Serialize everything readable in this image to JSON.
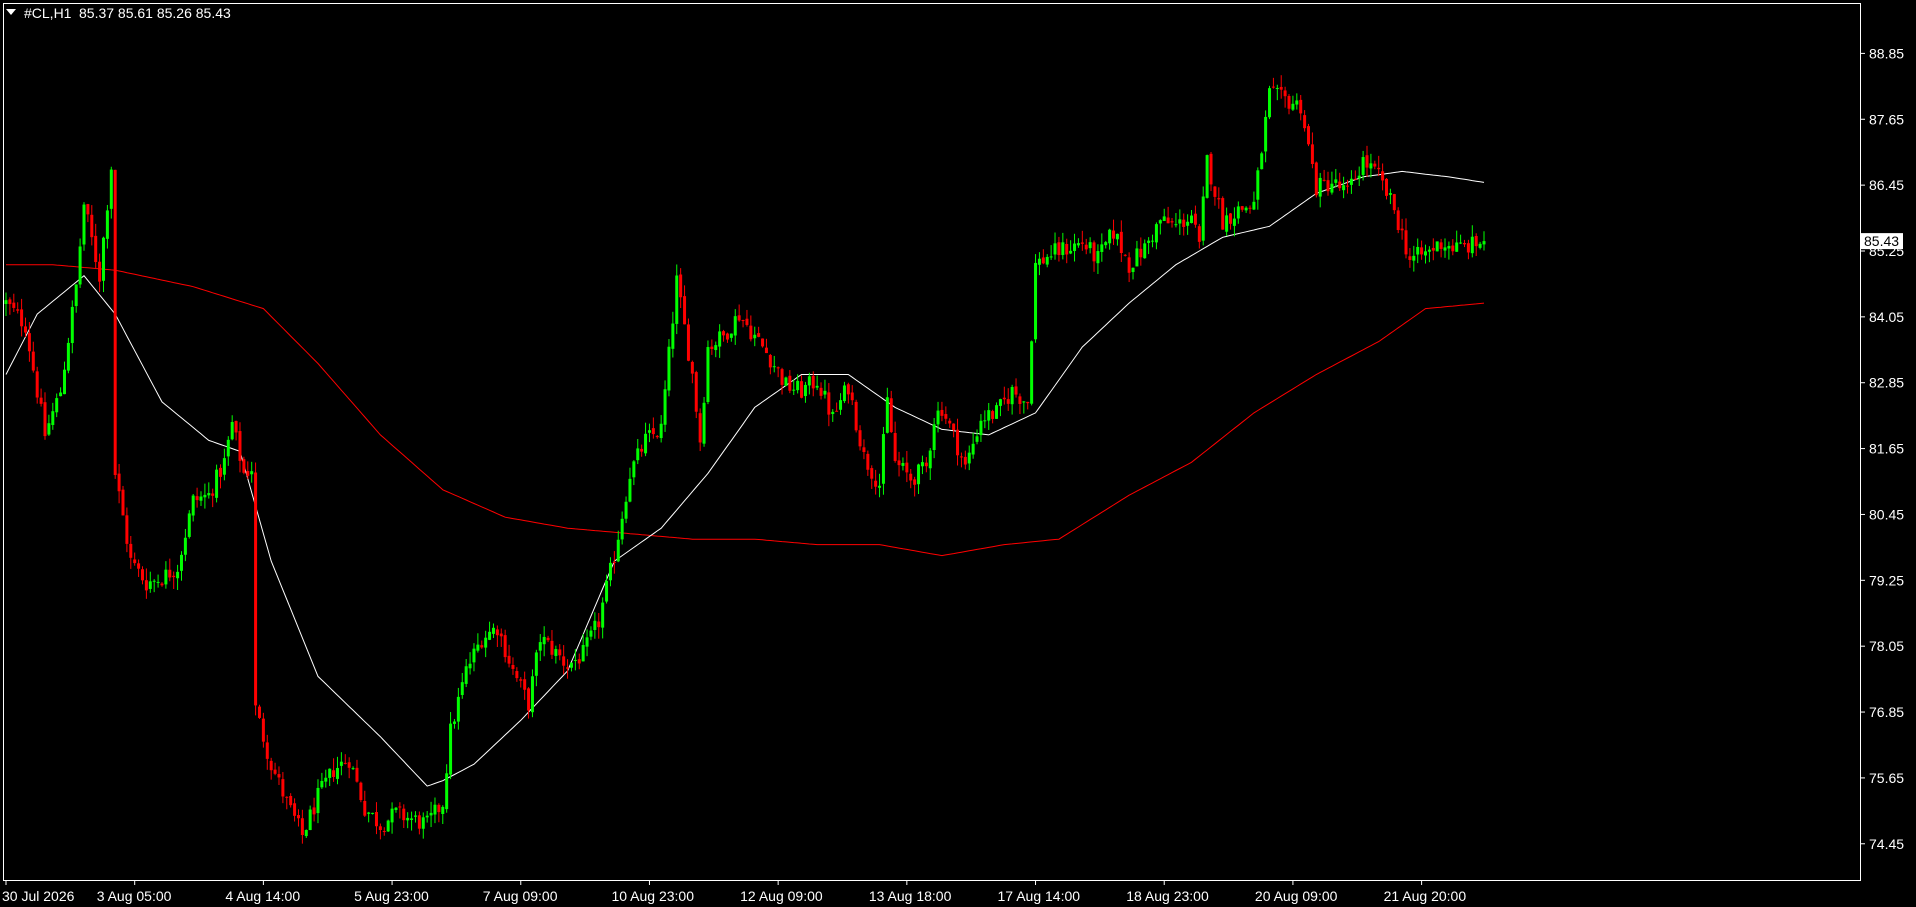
{
  "header": {
    "symbol": "#CL,H1",
    "ohlc": "85.37 85.61 85.26 85.43"
  },
  "chart_data": {
    "type": "candlestick",
    "symbol": "#CL",
    "timeframe": "H1",
    "y_ticks": [
      88.85,
      87.65,
      86.45,
      85.25,
      84.05,
      82.85,
      81.65,
      80.45,
      79.25,
      78.05,
      76.85,
      75.65,
      74.45
    ],
    "y_tick_labels": [
      "88.85",
      "87.65",
      "86.45",
      "85.25",
      "84.05",
      "82.85",
      "81.65",
      "80.45",
      "79.25",
      "78.05",
      "76.85",
      "75.65",
      "74.45"
    ],
    "ylim": [
      73.79,
      89.75
    ],
    "x_labels": [
      "30 Jul 2026",
      "3 Aug 05:00",
      "4 Aug 14:00",
      "5 Aug 23:00",
      "7 Aug 09:00",
      "10 Aug 23:00",
      "12 Aug 09:00",
      "13 Aug 18:00",
      "17 Aug 14:00",
      "18 Aug 23:00",
      "20 Aug 09:00",
      "21 Aug 20:00"
    ],
    "x_label_bar_index": [
      0,
      33,
      66,
      99,
      132,
      165,
      198,
      231,
      264,
      297,
      330,
      363
    ],
    "bar_count": 380,
    "bar_spacing_note": "candles evenly spaced",
    "current_price": "85.43",
    "last_ohlc": {
      "open": 85.37,
      "high": 85.61,
      "low": 85.26,
      "close": 85.43
    },
    "colors": {
      "bull": "#00ff00",
      "bear": "#ff0000",
      "fast_ma": "#ffffff",
      "slow_ma": "#ff0000",
      "background": "#000000",
      "axis": "#ffffff",
      "price_box": "#ffffff"
    },
    "anchors": [
      [
        0,
        84.3
      ],
      [
        5,
        83.9
      ],
      [
        10,
        81.9
      ],
      [
        14,
        82.7
      ],
      [
        18,
        84.6
      ],
      [
        20,
        86.1
      ],
      [
        24,
        84.8
      ],
      [
        27,
        86.8
      ],
      [
        28,
        81.2
      ],
      [
        32,
        79.6
      ],
      [
        36,
        79.2
      ],
      [
        40,
        79.3
      ],
      [
        44,
        79.5
      ],
      [
        48,
        80.7
      ],
      [
        52,
        80.8
      ],
      [
        56,
        81.4
      ],
      [
        58,
        82.1
      ],
      [
        61,
        81.2
      ],
      [
        63,
        81.3
      ],
      [
        64,
        76.9
      ],
      [
        68,
        75.9
      ],
      [
        72,
        75.2
      ],
      [
        76,
        74.6
      ],
      [
        80,
        75.3
      ],
      [
        84,
        75.8
      ],
      [
        88,
        76.0
      ],
      [
        92,
        75.1
      ],
      [
        96,
        74.8
      ],
      [
        100,
        75.0
      ],
      [
        104,
        74.9
      ],
      [
        108,
        74.8
      ],
      [
        112,
        75.2
      ],
      [
        114,
        76.5
      ],
      [
        118,
        77.6
      ],
      [
        122,
        78.2
      ],
      [
        126,
        78.4
      ],
      [
        130,
        77.6
      ],
      [
        134,
        77.0
      ],
      [
        137,
        78.2
      ],
      [
        140,
        78.0
      ],
      [
        144,
        77.7
      ],
      [
        148,
        77.9
      ],
      [
        152,
        78.5
      ],
      [
        156,
        79.7
      ],
      [
        160,
        81.2
      ],
      [
        164,
        81.8
      ],
      [
        168,
        82.0
      ],
      [
        172,
        84.7
      ],
      [
        176,
        83.0
      ],
      [
        178,
        81.8
      ],
      [
        180,
        83.5
      ],
      [
        184,
        83.7
      ],
      [
        188,
        84.1
      ],
      [
        192,
        83.7
      ],
      [
        196,
        83.3
      ],
      [
        200,
        82.8
      ],
      [
        204,
        82.7
      ],
      [
        208,
        82.9
      ],
      [
        212,
        82.2
      ],
      [
        216,
        82.8
      ],
      [
        220,
        81.5
      ],
      [
        224,
        81.0
      ],
      [
        226,
        82.5
      ],
      [
        228,
        81.4
      ],
      [
        232,
        81.1
      ],
      [
        236,
        81.3
      ],
      [
        238,
        82.2
      ],
      [
        240,
        82.4
      ],
      [
        244,
        81.7
      ],
      [
        246,
        81.3
      ],
      [
        250,
        82.2
      ],
      [
        254,
        82.3
      ],
      [
        258,
        82.7
      ],
      [
        262,
        82.5
      ],
      [
        264,
        85.0
      ],
      [
        268,
        85.2
      ],
      [
        272,
        85.3
      ],
      [
        276,
        85.4
      ],
      [
        280,
        85.1
      ],
      [
        284,
        85.6
      ],
      [
        288,
        85.0
      ],
      [
        292,
        85.3
      ],
      [
        296,
        85.8
      ],
      [
        300,
        85.7
      ],
      [
        304,
        85.9
      ],
      [
        306,
        85.3
      ],
      [
        308,
        86.9
      ],
      [
        312,
        85.8
      ],
      [
        316,
        86.0
      ],
      [
        320,
        86.1
      ],
      [
        324,
        88.1
      ],
      [
        328,
        88.0
      ],
      [
        332,
        87.9
      ],
      [
        336,
        86.4
      ],
      [
        340,
        86.5
      ],
      [
        344,
        86.3
      ],
      [
        348,
        86.9
      ],
      [
        352,
        86.6
      ],
      [
        356,
        86.0
      ],
      [
        360,
        85.1
      ],
      [
        364,
        85.2
      ],
      [
        368,
        85.4
      ],
      [
        372,
        85.3
      ],
      [
        376,
        85.35
      ],
      [
        379,
        85.43
      ]
    ],
    "fast_ma_anchors": [
      [
        0,
        83.0
      ],
      [
        8,
        84.1
      ],
      [
        20,
        84.8
      ],
      [
        28,
        84.1
      ],
      [
        40,
        82.5
      ],
      [
        52,
        81.8
      ],
      [
        60,
        81.6
      ],
      [
        68,
        79.6
      ],
      [
        80,
        77.5
      ],
      [
        96,
        76.4
      ],
      [
        108,
        75.5
      ],
      [
        112,
        75.6
      ],
      [
        120,
        75.9
      ],
      [
        132,
        76.7
      ],
      [
        144,
        77.6
      ],
      [
        156,
        79.6
      ],
      [
        168,
        80.2
      ],
      [
        180,
        81.2
      ],
      [
        192,
        82.4
      ],
      [
        204,
        83.0
      ],
      [
        216,
        83.0
      ],
      [
        228,
        82.4
      ],
      [
        240,
        82.0
      ],
      [
        252,
        81.9
      ],
      [
        264,
        82.3
      ],
      [
        276,
        83.5
      ],
      [
        288,
        84.3
      ],
      [
        300,
        85.0
      ],
      [
        312,
        85.5
      ],
      [
        324,
        85.7
      ],
      [
        336,
        86.3
      ],
      [
        348,
        86.6
      ],
      [
        358,
        86.7
      ],
      [
        370,
        86.6
      ],
      [
        379,
        86.5
      ]
    ],
    "slow_ma_anchors": [
      [
        0,
        85.0
      ],
      [
        12,
        85.0
      ],
      [
        28,
        84.9
      ],
      [
        48,
        84.6
      ],
      [
        66,
        84.2
      ],
      [
        80,
        83.2
      ],
      [
        96,
        81.9
      ],
      [
        112,
        80.9
      ],
      [
        128,
        80.4
      ],
      [
        144,
        80.2
      ],
      [
        160,
        80.1
      ],
      [
        176,
        80.0
      ],
      [
        192,
        80.0
      ],
      [
        208,
        79.9
      ],
      [
        224,
        79.9
      ],
      [
        240,
        79.7
      ],
      [
        256,
        79.9
      ],
      [
        270,
        80.0
      ],
      [
        288,
        80.8
      ],
      [
        304,
        81.4
      ],
      [
        320,
        82.3
      ],
      [
        336,
        83.0
      ],
      [
        352,
        83.6
      ],
      [
        364,
        84.2
      ],
      [
        379,
        84.3
      ]
    ]
  }
}
